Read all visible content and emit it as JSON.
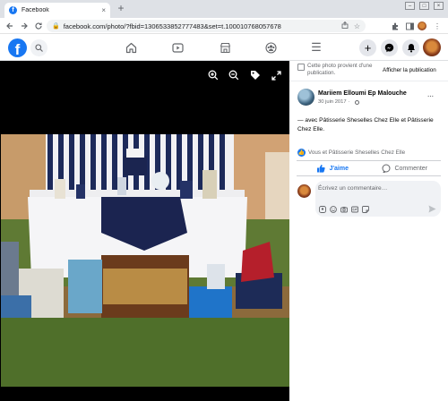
{
  "browser": {
    "tab_title": "Facebook",
    "tab_favicon": "f",
    "tab_close": "×",
    "new_tab": "+",
    "url": "facebook.com/photo/?fbid=1306533852777483&set=t.100010768057678",
    "window_controls": [
      "minimize-icon",
      "restore-icon",
      "close-icon"
    ]
  },
  "header": {
    "logo": "f",
    "nav_icons": [
      "home-icon",
      "watch-icon",
      "marketplace-icon",
      "groups-icon",
      "menu-icon"
    ],
    "action_icons": [
      "plus-icon",
      "messenger-icon",
      "bell-icon"
    ],
    "create_label": "+",
    "menu_glyph": "☰"
  },
  "viewer": {
    "tools": [
      "zoom-in-icon",
      "zoom-out-icon",
      "tag-icon",
      "fullscreen-icon"
    ]
  },
  "panel": {
    "notice_text": "Cette photo provient d'une publication.",
    "notice_link": "Afficher la publication",
    "author": "Mariiem Elloumi Ep Malouche",
    "date": "30 juin 2017",
    "meta_separator": "·",
    "more_label": "···",
    "caption": "— avec Pâtisserie Sheselles Chez Elle et Pâtisserie Chez Elle.",
    "reactions": "Vous et Pâtisserie Sheselles Chez Elle",
    "like_label": "J'aime",
    "comment_label": "Commenter",
    "comment_placeholder": "Écrivez un commentaire…"
  },
  "colors": {
    "facebook_blue": "#1877f2",
    "viewer_background": "#000000",
    "comment_box": "#f0f2f5"
  }
}
